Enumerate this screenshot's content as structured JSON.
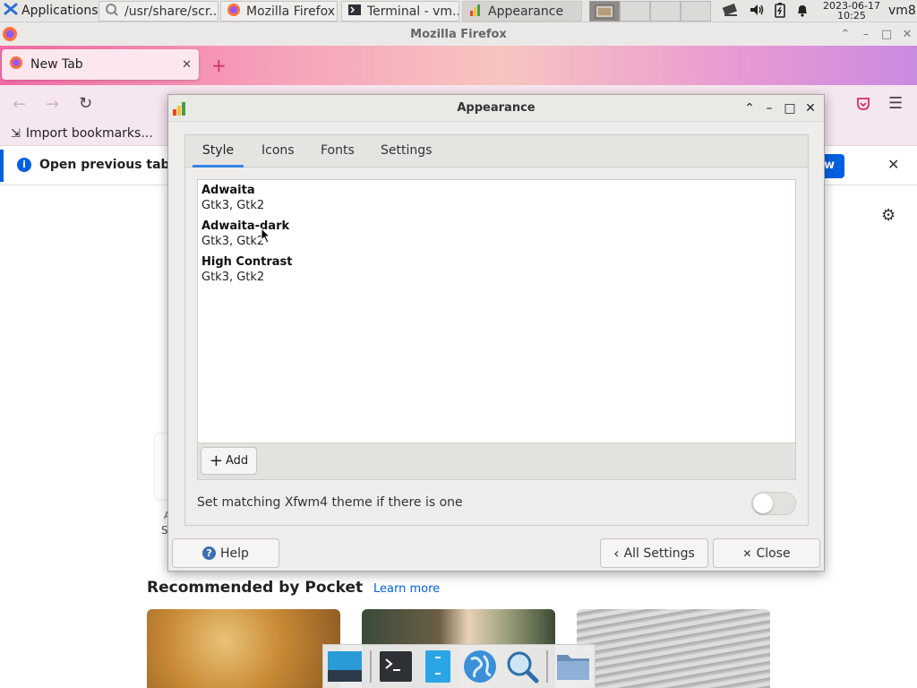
{
  "taskbar": {
    "apps_label": "Applications",
    "tasks": [
      {
        "label": "/usr/share/scr...",
        "icon": "file-manager-icon"
      },
      {
        "label": "Mozilla Firefox",
        "icon": "firefox-icon"
      },
      {
        "label": "Terminal - vm...",
        "icon": "terminal-icon"
      },
      {
        "label": "Appearance",
        "icon": "appearance-icon"
      }
    ],
    "clock_date": "2023-06-17",
    "clock_time": "10:25",
    "user": "vm8"
  },
  "firefox": {
    "window_title": "Mozilla Firefox",
    "tab_label": "New Tab",
    "bookmark_label": "Import bookmarks...",
    "notice_text": "Open previous tabs",
    "notice_button": "w",
    "pocket_title": "Recommended by Pocket",
    "pocket_link": "Learn more",
    "partial_text_a": "A",
    "partial_text_b": "S"
  },
  "dialog": {
    "title": "Appearance",
    "tabs": [
      "Style",
      "Icons",
      "Fonts",
      "Settings"
    ],
    "active_tab": "Style",
    "themes": [
      {
        "name": "Adwaita",
        "toolkits": "Gtk3, Gtk2"
      },
      {
        "name": "Adwaita-dark",
        "toolkits": "Gtk3, Gtk2"
      },
      {
        "name": "High Contrast",
        "toolkits": "Gtk3, Gtk2"
      }
    ],
    "add_label": "Add",
    "xfwm_label": "Set matching Xfwm4 theme if there is one",
    "xfwm_toggle_on": false,
    "help_label": "Help",
    "all_settings_label": "All Settings",
    "close_label": "Close"
  },
  "colors": {
    "accent": "#3584e4",
    "firefox_notice_blue": "#0061e0",
    "pocket_link": "#0060df"
  }
}
